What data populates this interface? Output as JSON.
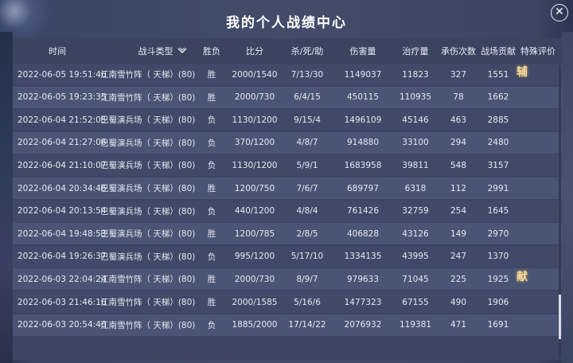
{
  "window": {
    "title": "我的个人战绩中心",
    "close_label": "✕"
  },
  "columns": {
    "time": "时间",
    "type": "战斗类型",
    "result": "胜负",
    "score": "比分",
    "kda": "杀/死/助",
    "damage": "伤害量",
    "heal": "治疗量",
    "hits_taken": "承伤次数",
    "contribution": "战场贡献",
    "special": "特殊评价"
  },
  "rows": [
    {
      "time": "2022-06-05 19:51:46",
      "type": "江南雪竹阵（ 天梯）(80)",
      "result": "胜",
      "score": "2000/1540",
      "kda": "7/13/30",
      "damage": "1149037",
      "heal": "11823",
      "hits_taken": "327",
      "contribution": "1551",
      "special": "辅"
    },
    {
      "time": "2022-06-05 19:23:35",
      "type": "江南雪竹阵（ 天梯）(80)",
      "result": "胜",
      "score": "2000/730",
      "kda": "6/4/15",
      "damage": "450115",
      "heal": "110935",
      "hits_taken": "78",
      "contribution": "1662",
      "special": ""
    },
    {
      "time": "2022-06-04 21:52:05",
      "type": "巴蜀演兵场（ 天梯）(80)",
      "result": "负",
      "score": "1130/1200",
      "kda": "9/15/4",
      "damage": "1496109",
      "heal": "45146",
      "hits_taken": "463",
      "contribution": "2885",
      "special": ""
    },
    {
      "time": "2022-06-04 21:27:06",
      "type": "巴蜀演兵场（ 天梯）(80)",
      "result": "负",
      "score": "370/1200",
      "kda": "4/8/7",
      "damage": "914880",
      "heal": "33100",
      "hits_taken": "294",
      "contribution": "2480",
      "special": ""
    },
    {
      "time": "2022-06-04 21:10:07",
      "type": "巴蜀演兵场（ 天梯）(80)",
      "result": "负",
      "score": "1130/1200",
      "kda": "5/9/1",
      "damage": "1683958",
      "heal": "39811",
      "hits_taken": "548",
      "contribution": "3157",
      "special": ""
    },
    {
      "time": "2022-06-04 20:34:46",
      "type": "巴蜀演兵场（ 天梯）(80)",
      "result": "胜",
      "score": "1200/750",
      "kda": "7/6/7",
      "damage": "689797",
      "heal": "6318",
      "hits_taken": "112",
      "contribution": "2991",
      "special": ""
    },
    {
      "time": "2022-06-04 20:13:54",
      "type": "巴蜀演兵场（ 天梯）(80)",
      "result": "负",
      "score": "440/1200",
      "kda": "4/8/4",
      "damage": "761426",
      "heal": "32759",
      "hits_taken": "254",
      "contribution": "1645",
      "special": ""
    },
    {
      "time": "2022-06-04 19:48:53",
      "type": "巴蜀演兵场（ 天梯）(80)",
      "result": "胜",
      "score": "1200/785",
      "kda": "2/8/5",
      "damage": "406828",
      "heal": "43126",
      "hits_taken": "149",
      "contribution": "2970",
      "special": ""
    },
    {
      "time": "2022-06-04 19:26:37",
      "type": "巴蜀演兵场（ 天梯）(80)",
      "result": "负",
      "score": "995/1200",
      "kda": "5/17/10",
      "damage": "1334135",
      "heal": "43995",
      "hits_taken": "247",
      "contribution": "1370",
      "special": ""
    },
    {
      "time": "2022-06-03 22:04:24",
      "type": "江南雪竹阵（ 天梯）(80)",
      "result": "胜",
      "score": "2000/730",
      "kda": "8/9/7",
      "damage": "979633",
      "heal": "71045",
      "hits_taken": "225",
      "contribution": "1925",
      "special": "献"
    },
    {
      "time": "2022-06-03 21:46:16",
      "type": "江南雪竹阵（ 天梯）(80)",
      "result": "胜",
      "score": "2000/1585",
      "kda": "5/16/6",
      "damage": "1477323",
      "heal": "67155",
      "hits_taken": "490",
      "contribution": "1906",
      "special": ""
    },
    {
      "time": "2022-06-03 20:54:46",
      "type": "江南雪竹阵（ 天梯）(80)",
      "result": "负",
      "score": "1885/2000",
      "kda": "17/14/22",
      "damage": "2076932",
      "heal": "119381",
      "hits_taken": "471",
      "contribution": "1691",
      "special": ""
    }
  ],
  "icons": {
    "sort": "sort-chevron-down-icon",
    "close": "close-icon"
  }
}
